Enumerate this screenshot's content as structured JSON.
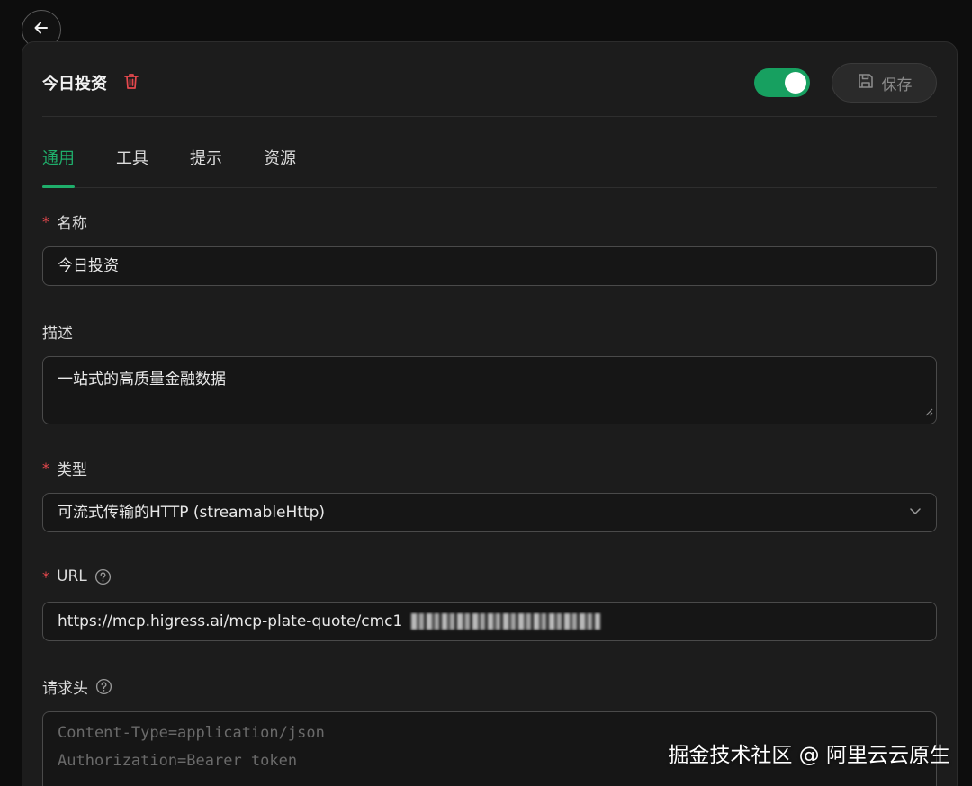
{
  "header": {
    "title": "今日投资",
    "toggle_on": true,
    "save_label": "保存"
  },
  "tabs": [
    {
      "label": "通用",
      "active": true
    },
    {
      "label": "工具",
      "active": false
    },
    {
      "label": "提示",
      "active": false
    },
    {
      "label": "资源",
      "active": false
    }
  ],
  "form": {
    "name": {
      "label": "名称",
      "required": true,
      "value": "今日投资"
    },
    "description": {
      "label": "描述",
      "required": false,
      "value": "一站式的高质量金融数据"
    },
    "type": {
      "label": "类型",
      "required": true,
      "value": "可流式传输的HTTP (streamableHttp)"
    },
    "url": {
      "label": "URL",
      "required": true,
      "value": "https://mcp.higress.ai/mcp-plate-quote/cmc1"
    },
    "headers": {
      "label": "请求头",
      "placeholder_line1": "Content-Type=application/json",
      "placeholder_line2": "Authorization=Bearer token"
    }
  },
  "watermark": "掘金技术社区 @ 阿里云云原生",
  "colors": {
    "accent": "#1fae6b",
    "toggle": "#17a060",
    "danger": "#e5484d"
  },
  "icons": [
    "arrow-left-icon",
    "trash-icon",
    "save-disk-icon",
    "question-circle-icon",
    "chevron-down-icon",
    "resize-grip-icon"
  ]
}
